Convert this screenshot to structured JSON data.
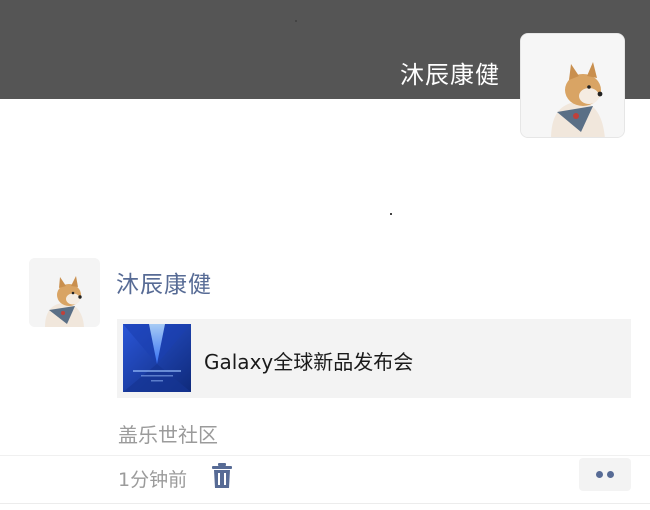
{
  "profile": {
    "name": "沐辰康健",
    "avatar_icon": "shiba-dog-avatar"
  },
  "post": {
    "author": "沐辰康健",
    "link": {
      "title": "Galaxy全球新品发布会",
      "thumbnail_icon": "galaxy-launch-thumbnail"
    },
    "source": "盖乐世社区",
    "time": "1分钟前",
    "delete_icon": "trash-icon",
    "more_icon": "more-dots-icon"
  },
  "colors": {
    "cover": "#555555",
    "link_blue": "#576b95",
    "card_bg": "#f3f3f3",
    "muted_text": "#9b9b9b"
  }
}
